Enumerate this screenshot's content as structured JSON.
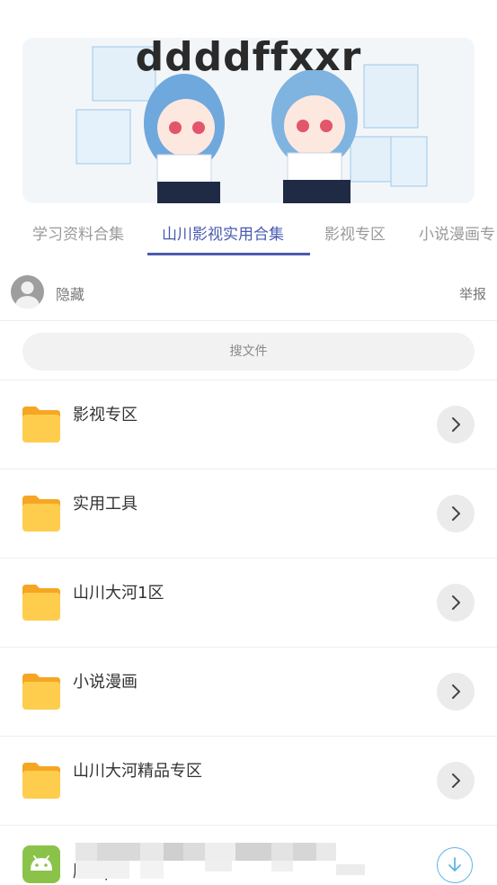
{
  "banner": {
    "title": "ddddffxxr"
  },
  "tabs": [
    {
      "label": "学习资料合集"
    },
    {
      "label": "山川影视实用合集"
    },
    {
      "label": "影视专区"
    },
    {
      "label": "小说漫画专"
    }
  ],
  "owner": {
    "name": "隐藏",
    "report_label": "举报"
  },
  "search": {
    "placeholder": "搜文件"
  },
  "folders": [
    {
      "name": "影视专区"
    },
    {
      "name": "实用工具"
    },
    {
      "name": "山川大河1区"
    },
    {
      "name": "小说漫画"
    },
    {
      "name": "山川大河精品专区"
    }
  ],
  "apk": {
    "name_visible": "版.apk"
  },
  "colors": {
    "accent": "#4a5bb0",
    "folder": "#ffcd4d",
    "folder_tab": "#f6a623",
    "android": "#8bc34a",
    "download": "#5fb4e8"
  },
  "icons": {
    "folder": "folder-icon",
    "chevron": "chevron-right-icon",
    "download": "download-icon",
    "avatar": "user-avatar-icon",
    "android": "android-icon"
  }
}
